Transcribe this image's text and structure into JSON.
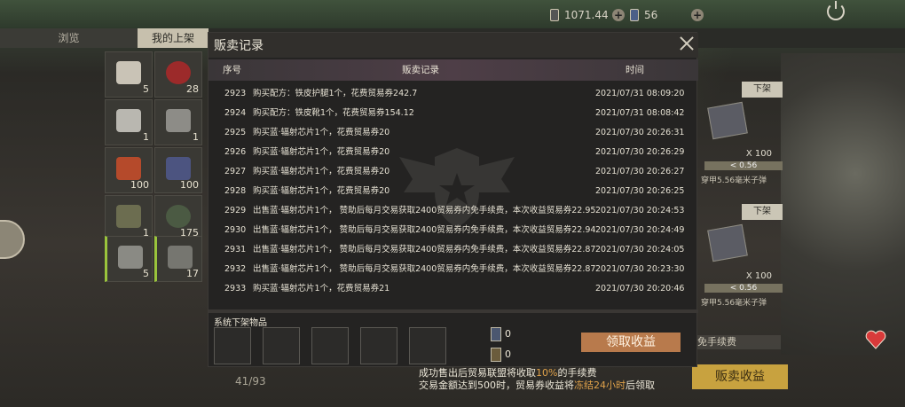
{
  "hud": {
    "currency_a": "1071.44",
    "currency_b": "56"
  },
  "tabs": [
    {
      "label": "浏览"
    },
    {
      "label": "我的上架"
    }
  ],
  "inventory": {
    "slots": [
      {
        "count": "5"
      },
      {
        "count": "28"
      },
      {
        "count": "1"
      },
      {
        "count": "1"
      },
      {
        "count": "100"
      },
      {
        "count": "100"
      },
      {
        "count": "1"
      },
      {
        "count": "175"
      },
      {
        "count": "5"
      },
      {
        "count": "17"
      }
    ],
    "page": "41/93"
  },
  "right_listings": [
    {
      "off_label": "下架",
      "qty": "X 100",
      "price": "< 0.56",
      "name": "穿甲5.56毫米子弹"
    },
    {
      "off_label": "下架",
      "qty": "X 100",
      "price": "< 0.56",
      "name": "穿甲5.56毫米子弹"
    }
  ],
  "bg_notice": "以内免手续费",
  "sell_revenue_button": "贩卖收益",
  "tip": {
    "line1_a": "成功售出后贸易联盟将收取",
    "line1_hl": "10%",
    "line1_b": "的手续费",
    "line2_a": "交易金额达到500时，贸易券收益将",
    "line2_hl": "冻结24小时",
    "line2_b": "后领取"
  },
  "modal": {
    "title": "贩卖记录",
    "headers": {
      "seq": "序号",
      "record": "贩卖记录",
      "time": "时间"
    },
    "rows": [
      {
        "seq": "2923",
        "record": "购买配方：铁皮护腿1个，花费贸易券242.7",
        "time": "2021/07/31 08:09:20"
      },
      {
        "seq": "2924",
        "record": "购买配方：铁皮靴1个，花费贸易券154.12",
        "time": "2021/07/31 08:08:42"
      },
      {
        "seq": "2925",
        "record": "购买蓝·辐射芯片1个，花费贸易券20",
        "time": "2021/07/30 20:26:31"
      },
      {
        "seq": "2926",
        "record": "购买蓝·辐射芯片1个，花费贸易券20",
        "time": "2021/07/30 20:26:29"
      },
      {
        "seq": "2927",
        "record": "购买蓝·辐射芯片1个，花费贸易券20",
        "time": "2021/07/30 20:26:27"
      },
      {
        "seq": "2928",
        "record": "购买蓝·辐射芯片1个，花费贸易券20",
        "time": "2021/07/30 20:26:25"
      },
      {
        "seq": "2929",
        "record": "出售蓝·辐射芯片1个， 赞助后每月交易获取2400贸易券内免手续费，本次收益贸易券22.95",
        "time": "2021/07/30 20:24:53"
      },
      {
        "seq": "2930",
        "record": "出售蓝·辐射芯片1个， 赞助后每月交易获取2400贸易券内免手续费，本次收益贸易券22.94",
        "time": "2021/07/30 20:24:49"
      },
      {
        "seq": "2931",
        "record": "出售蓝·辐射芯片1个， 赞助后每月交易获取2400贸易券内免手续费，本次收益贸易券22.87",
        "time": "2021/07/30 20:24:05"
      },
      {
        "seq": "2932",
        "record": "出售蓝·辐射芯片1个， 赞助后每月交易获取2400贸易券内免手续费，本次收益贸易券22.87",
        "time": "2021/07/30 20:23:30"
      },
      {
        "seq": "2933",
        "record": "购买蓝·辐射芯片1个，花费贸易券21",
        "time": "2021/07/30 20:20:46"
      }
    ],
    "system_title": "系统下架物品",
    "ticket_a": "0",
    "ticket_b": "0",
    "collect_button": "领取收益"
  }
}
